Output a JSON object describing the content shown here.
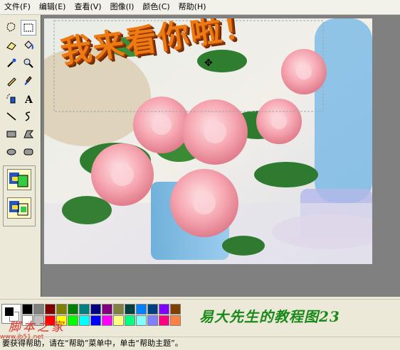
{
  "menu": [
    {
      "label": "文件(F)"
    },
    {
      "label": "编辑(E)"
    },
    {
      "label": "查看(V)"
    },
    {
      "label": "图像(I)"
    },
    {
      "label": "颜色(C)"
    },
    {
      "label": "帮助(H)"
    }
  ],
  "tools": [
    "free-form-select-icon",
    "rect-select-icon",
    "eraser-icon",
    "fill-icon",
    "pick-color-icon",
    "magnifier-icon",
    "pencil-icon",
    "brush-icon",
    "airbrush-icon",
    "text-icon",
    "line-icon",
    "curve-icon",
    "rectangle-icon",
    "polygon-icon",
    "ellipse-icon",
    "rounded-rect-icon"
  ],
  "selected_tool": "rect-select-icon",
  "canvas": {
    "overlay_text": "我来看你啦！"
  },
  "palette": {
    "foreground": "#000000",
    "background": "#ffffff",
    "colors": [
      "#000000",
      "#808080",
      "#800000",
      "#808000",
      "#008000",
      "#008080",
      "#000080",
      "#800080",
      "#808040",
      "#004040",
      "#0080ff",
      "#004080",
      "#8000ff",
      "#804000",
      "#ffffff",
      "#c0c0c0",
      "#ff0000",
      "#ffff00",
      "#00ff00",
      "#00ffff",
      "#0000ff",
      "#ff00ff",
      "#ffff80",
      "#00ff80",
      "#80ffff",
      "#8080ff",
      "#ff0080",
      "#ff8040"
    ]
  },
  "caption": "易大先生的教程图23",
  "status": "要获得帮助，请在“帮助”菜单中，单击“帮助主题”。",
  "watermark": {
    "text": "脚本之家",
    "url": "www.jb51.net"
  }
}
